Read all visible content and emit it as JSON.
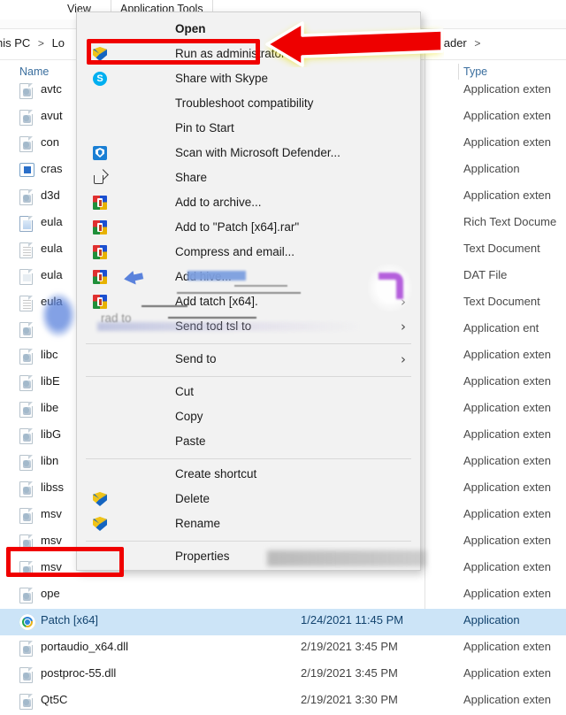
{
  "window": {
    "ribbon_tabs": [
      {
        "label": "View",
        "name": "tab-view"
      },
      {
        "label": "Application Tools",
        "name": "tab-application-tools"
      }
    ],
    "breadcrumb_left": "his PC",
    "breadcrumb_left_2": "Lo",
    "breadcrumb_right": "wnloader",
    "breadcrumb_separator": ">"
  },
  "columns": {
    "name": "Name",
    "type": "Type"
  },
  "files": [
    {
      "name": "avtc",
      "type": "Application exten",
      "date": "",
      "icon": "dll-file-icon",
      "selected": false
    },
    {
      "name": "avut",
      "type": "Application exten",
      "date": "",
      "icon": "dll-file-icon",
      "selected": false
    },
    {
      "name": "con",
      "type": "Application exten",
      "date": "",
      "icon": "dll-file-icon",
      "selected": false
    },
    {
      "name": "cras",
      "type": "Application",
      "date": "",
      "icon": "exe-file-icon",
      "selected": false
    },
    {
      "name": "d3d",
      "type": "Application exten",
      "date": "",
      "icon": "dll-file-icon",
      "selected": false
    },
    {
      "name": "eula",
      "type": "Rich Text Docume",
      "date": "",
      "icon": "rtf-file-icon",
      "selected": false
    },
    {
      "name": "eula",
      "type": "Text Document",
      "date": "",
      "icon": "txt-file-icon",
      "selected": false
    },
    {
      "name": "eula",
      "type": "DAT File",
      "date": "",
      "icon": "dat-file-icon",
      "selected": false
    },
    {
      "name": "eula",
      "type": "Text Document",
      "date": "",
      "icon": "txt-file-icon",
      "selected": false
    },
    {
      "name": "",
      "type": "Application ent",
      "date": "",
      "icon": "dll-file-icon",
      "selected": false
    },
    {
      "name": "libc",
      "type": "Application exten",
      "date": "",
      "icon": "dll-file-icon",
      "selected": false
    },
    {
      "name": "libE",
      "type": "Application exten",
      "date": "",
      "icon": "dll-file-icon",
      "selected": false
    },
    {
      "name": "libe",
      "type": "Application exten",
      "date": "",
      "icon": "dll-file-icon",
      "selected": false
    },
    {
      "name": "libG",
      "type": "Application exten",
      "date": "",
      "icon": "dll-file-icon",
      "selected": false
    },
    {
      "name": "libn",
      "type": "Application exten",
      "date": "",
      "icon": "dll-file-icon",
      "selected": false
    },
    {
      "name": "libss",
      "type": "Application exten",
      "date": "",
      "icon": "dll-file-icon",
      "selected": false
    },
    {
      "name": "msv",
      "type": "Application exten",
      "date": "",
      "icon": "dll-file-icon",
      "selected": false
    },
    {
      "name": "msv",
      "type": "Application exten",
      "date": "",
      "icon": "dll-file-icon",
      "selected": false
    },
    {
      "name": "msv",
      "type": "Application exten",
      "date": "",
      "icon": "dll-file-icon",
      "selected": false
    },
    {
      "name": "ope",
      "type": "Application exten",
      "date": "",
      "icon": "dll-file-icon",
      "selected": false
    },
    {
      "name": "Patch [x64]",
      "type": "Application",
      "date": "1/24/2021 11:45 PM",
      "icon": "patch-app-icon",
      "selected": true
    },
    {
      "name": "portaudio_x64.dll",
      "type": "Application exten",
      "date": "2/19/2021 3:45 PM",
      "icon": "dll-file-icon",
      "selected": false
    },
    {
      "name": "postproc-55.dll",
      "type": "Application exten",
      "date": "2/19/2021 3:45 PM",
      "icon": "dll-file-icon",
      "selected": false
    },
    {
      "name": "Qt5C",
      "type": "Application exten",
      "date": "2/19/2021 3:30 PM",
      "icon": "dll-file-icon",
      "selected": false
    }
  ],
  "context_menu": {
    "items": [
      {
        "label": "Open",
        "icon": null,
        "bold": true,
        "submenu": false,
        "sep_after": false
      },
      {
        "label": "Run as administrator",
        "icon": "uac-shield-icon",
        "bold": false,
        "submenu": false,
        "sep_after": false
      },
      {
        "label": "Share with Skype",
        "icon": "skype-icon",
        "bold": false,
        "submenu": false,
        "sep_after": false
      },
      {
        "label": "Troubleshoot compatibility",
        "icon": null,
        "bold": false,
        "submenu": false,
        "sep_after": false
      },
      {
        "label": "Pin to Start",
        "icon": null,
        "bold": false,
        "submenu": false,
        "sep_after": false
      },
      {
        "label": "Scan with Microsoft Defender...",
        "icon": "defender-icon",
        "bold": false,
        "submenu": false,
        "sep_after": false
      },
      {
        "label": "Share",
        "icon": "share-icon",
        "bold": false,
        "submenu": false,
        "sep_after": false
      },
      {
        "label": "Add to archive...",
        "icon": "winrar-icon",
        "bold": false,
        "submenu": false,
        "sep_after": false
      },
      {
        "label": "Add to \"Patch [x64].rar\"",
        "icon": "winrar-icon",
        "bold": false,
        "submenu": false,
        "sep_after": false
      },
      {
        "label": "Compress and email...",
        "icon": "winrar-icon",
        "bold": false,
        "submenu": false,
        "sep_after": false
      },
      {
        "label": "Add  hive...",
        "icon": "winrar-icon",
        "bold": false,
        "submenu": false,
        "sep_after": false
      },
      {
        "label": "Add tatch [x64].",
        "icon": "winrar-icon",
        "bold": false,
        "submenu": true,
        "sep_after": false
      },
      {
        "label": "Send tod tsl to",
        "icon": null,
        "bold": false,
        "submenu": true,
        "sep_after": true
      },
      {
        "label": "Send to",
        "icon": null,
        "bold": false,
        "submenu": true,
        "sep_after": true
      },
      {
        "label": "Cut",
        "icon": null,
        "bold": false,
        "submenu": false,
        "sep_after": false
      },
      {
        "label": "Copy",
        "icon": null,
        "bold": false,
        "submenu": false,
        "sep_after": false
      },
      {
        "label": "Paste",
        "icon": null,
        "bold": false,
        "submenu": false,
        "sep_after": true
      },
      {
        "label": "Create shortcut",
        "icon": null,
        "bold": false,
        "submenu": false,
        "sep_after": false
      },
      {
        "label": "Delete",
        "icon": "uac-shield-icon",
        "bold": false,
        "submenu": false,
        "sep_after": false
      },
      {
        "label": "Rename",
        "icon": "uac-shield-icon",
        "bold": false,
        "submenu": false,
        "sep_after": true
      },
      {
        "label": "Properties",
        "icon": null,
        "bold": false,
        "submenu": false,
        "sep_after": false
      }
    ],
    "ghost_text": "rad to"
  },
  "annotations": {
    "arrow": {
      "name": "red-arrow-pointing-left",
      "color": "#ee0000",
      "glow_color": "#e8e000"
    },
    "highlight_run_as_admin": {
      "name": "red-highlight-box-run-as-administrator",
      "color": "#f00000"
    },
    "highlight_patch_file": {
      "name": "red-highlight-box-patch-file",
      "color": "#f00000"
    }
  },
  "colors": {
    "accent": "#f00000",
    "selection": "#cce4f7",
    "menu_bg": "#f2f2f2",
    "link": "#3a6e9e"
  }
}
